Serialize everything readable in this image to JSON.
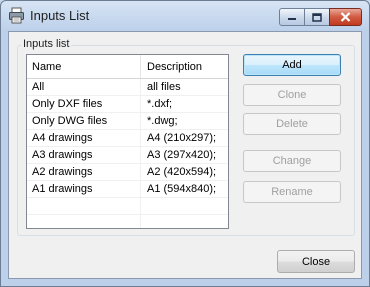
{
  "window": {
    "title": "Inputs List"
  },
  "group": {
    "label": "Inputs list"
  },
  "list": {
    "headers": {
      "name": "Name",
      "description": "Description"
    },
    "rows": [
      {
        "name": "All",
        "description": "all files"
      },
      {
        "name": "Only DXF files",
        "description": "*.dxf;"
      },
      {
        "name": "Only DWG files",
        "description": "*.dwg;"
      },
      {
        "name": "A4 drawings",
        "description": "A4 (210x297);"
      },
      {
        "name": "A3 drawings",
        "description": "A3 (297x420);"
      },
      {
        "name": "A2 drawings",
        "description": "A2 (420x594);"
      },
      {
        "name": "A1 drawings",
        "description": "A1 (594x840);"
      }
    ]
  },
  "buttons": {
    "add": "Add",
    "clone": "Clone",
    "delete": "Delete",
    "change": "Change",
    "rename": "Rename",
    "close": "Close"
  },
  "icons": {
    "app": "printer-icon",
    "minimize": "minimize-icon",
    "maximize": "maximize-icon",
    "close": "close-icon"
  },
  "colors": {
    "default_button_border": "#3c7fb1",
    "close_control": "#c7452b"
  }
}
